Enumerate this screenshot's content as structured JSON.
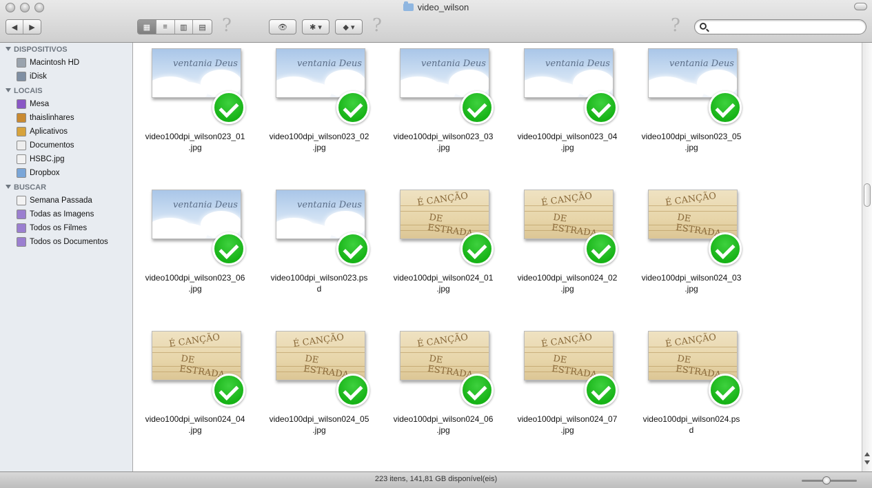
{
  "window": {
    "title": "video_wilson"
  },
  "toolbar": {
    "back_label": "◀",
    "forward_label": "▶",
    "view_icons_label": "▦",
    "view_list_label": "≡",
    "view_columns_label": "▥",
    "view_coverflow_label": "▤",
    "help_label": "?",
    "quicklook_label": "👁",
    "action_label": "✱ ▾",
    "dropbox_label": "◆ ▾",
    "search": {
      "value": "",
      "placeholder": ""
    }
  },
  "sidebar": {
    "sections": [
      {
        "title": "DISPOSITIVOS",
        "items": [
          {
            "label": "Macintosh HD",
            "icon": "hard-drive-icon",
            "color": "#9aa3ad"
          },
          {
            "label": "iDisk",
            "icon": "idisk-icon",
            "color": "#7f8fa3"
          }
        ]
      },
      {
        "title": "LOCAIS",
        "items": [
          {
            "label": "Mesa",
            "icon": "desktop-icon",
            "color": "#8a58c6"
          },
          {
            "label": "thaislinhares",
            "icon": "home-icon",
            "color": "#c98a32"
          },
          {
            "label": "Aplicativos",
            "icon": "applications-icon",
            "color": "#d7a33c"
          },
          {
            "label": "Documentos",
            "icon": "documents-icon",
            "color": "#eeeeee"
          },
          {
            "label": "HSBC.jpg",
            "icon": "image-file-icon",
            "color": "#f2f2f2"
          },
          {
            "label": "Dropbox",
            "icon": "dropbox-icon",
            "color": "#7aa6d8"
          }
        ]
      },
      {
        "title": "BUSCAR",
        "items": [
          {
            "label": "Semana Passada",
            "icon": "clock-icon",
            "color": "#f3f3f3"
          },
          {
            "label": "Todas as Imagens",
            "icon": "smart-folder-icon",
            "color": "#9b7fd0"
          },
          {
            "label": "Todos os Filmes",
            "icon": "smart-folder-icon",
            "color": "#9b7fd0"
          },
          {
            "label": "Todos os Documentos",
            "icon": "smart-folder-icon",
            "color": "#9b7fd0"
          }
        ]
      }
    ]
  },
  "files": [
    {
      "name": "video100dpi_wilson023_01.jpg",
      "line1": "video100dpi_wilson023_01",
      "line2": ".jpg",
      "thumb": "sky",
      "thumb_text": "ventania Deus",
      "synced": true
    },
    {
      "name": "video100dpi_wilson023_02.jpg",
      "line1": "video100dpi_wilson023_02",
      "line2": ".jpg",
      "thumb": "sky",
      "thumb_text": "ventania Deus",
      "synced": true
    },
    {
      "name": "video100dpi_wilson023_03.jpg",
      "line1": "video100dpi_wilson023_03",
      "line2": ".jpg",
      "thumb": "sky",
      "thumb_text": "ventania Deus",
      "synced": true
    },
    {
      "name": "video100dpi_wilson023_04.jpg",
      "line1": "video100dpi_wilson023_04",
      "line2": ".jpg",
      "thumb": "sky",
      "thumb_text": "ventania Deus",
      "synced": true
    },
    {
      "name": "video100dpi_wilson023_05.jpg",
      "line1": "video100dpi_wilson023_05",
      "line2": ".jpg",
      "thumb": "sky",
      "thumb_text": "ventania Deus",
      "synced": true
    },
    {
      "name": "video100dpi_wilson023_06.jpg",
      "line1": "video100dpi_wilson023_06",
      "line2": ".jpg",
      "thumb": "sky",
      "thumb_text": "ventania Deus",
      "synced": true
    },
    {
      "name": "video100dpi_wilson023.psd",
      "line1": "video100dpi_wilson023.ps",
      "line2": "d",
      "thumb": "sky",
      "thumb_text": "ventania Deus",
      "synced": true
    },
    {
      "name": "video100dpi_wilson024_01.jpg",
      "line1": "video100dpi_wilson024_01",
      "line2": ".jpg",
      "thumb": "sand",
      "thumb_text": "É CANÇÃO",
      "thumb_text2": "DE ESTRADA",
      "synced": true
    },
    {
      "name": "video100dpi_wilson024_02.jpg",
      "line1": "video100dpi_wilson024_02",
      "line2": ".jpg",
      "thumb": "sand",
      "thumb_text": "É CANÇÃO",
      "thumb_text2": "DE ESTRADA",
      "synced": true
    },
    {
      "name": "video100dpi_wilson024_03.jpg",
      "line1": "video100dpi_wilson024_03",
      "line2": ".jpg",
      "thumb": "sand",
      "thumb_text": "É CANÇÃO",
      "thumb_text2": "DE ESTRADA",
      "synced": true
    },
    {
      "name": "video100dpi_wilson024_04.jpg",
      "line1": "video100dpi_wilson024_04",
      "line2": ".jpg",
      "thumb": "sand",
      "thumb_text": "É CANÇÃO",
      "thumb_text2": "DE ESTRADA",
      "synced": true
    },
    {
      "name": "video100dpi_wilson024_05.jpg",
      "line1": "video100dpi_wilson024_05",
      "line2": ".jpg",
      "thumb": "sand",
      "thumb_text": "É CANÇÃO",
      "thumb_text2": "DE ESTRADA",
      "synced": true
    },
    {
      "name": "video100dpi_wilson024_06.jpg",
      "line1": "video100dpi_wilson024_06",
      "line2": ".jpg",
      "thumb": "sand",
      "thumb_text": "É CANÇÃO",
      "thumb_text2": "DE ESTRADA",
      "synced": true
    },
    {
      "name": "video100dpi_wilson024_07.jpg",
      "line1": "video100dpi_wilson024_07",
      "line2": ".jpg",
      "thumb": "sand",
      "thumb_text": "É CANÇÃO",
      "thumb_text2": "DE ESTRADA",
      "synced": true
    },
    {
      "name": "video100dpi_wilson024.psd",
      "line1": "video100dpi_wilson024.ps",
      "line2": "d",
      "thumb": "sand",
      "thumb_text": "É CANÇÃO",
      "thumb_text2": "DE ESTRADA",
      "synced": true
    }
  ],
  "status": {
    "text": "223 itens, 141,81 GB disponível(eis)",
    "icon_size_level": 0.45
  },
  "colors": {
    "sync_check": "#17b317",
    "sidebar_bg": "#e8ecf1"
  }
}
